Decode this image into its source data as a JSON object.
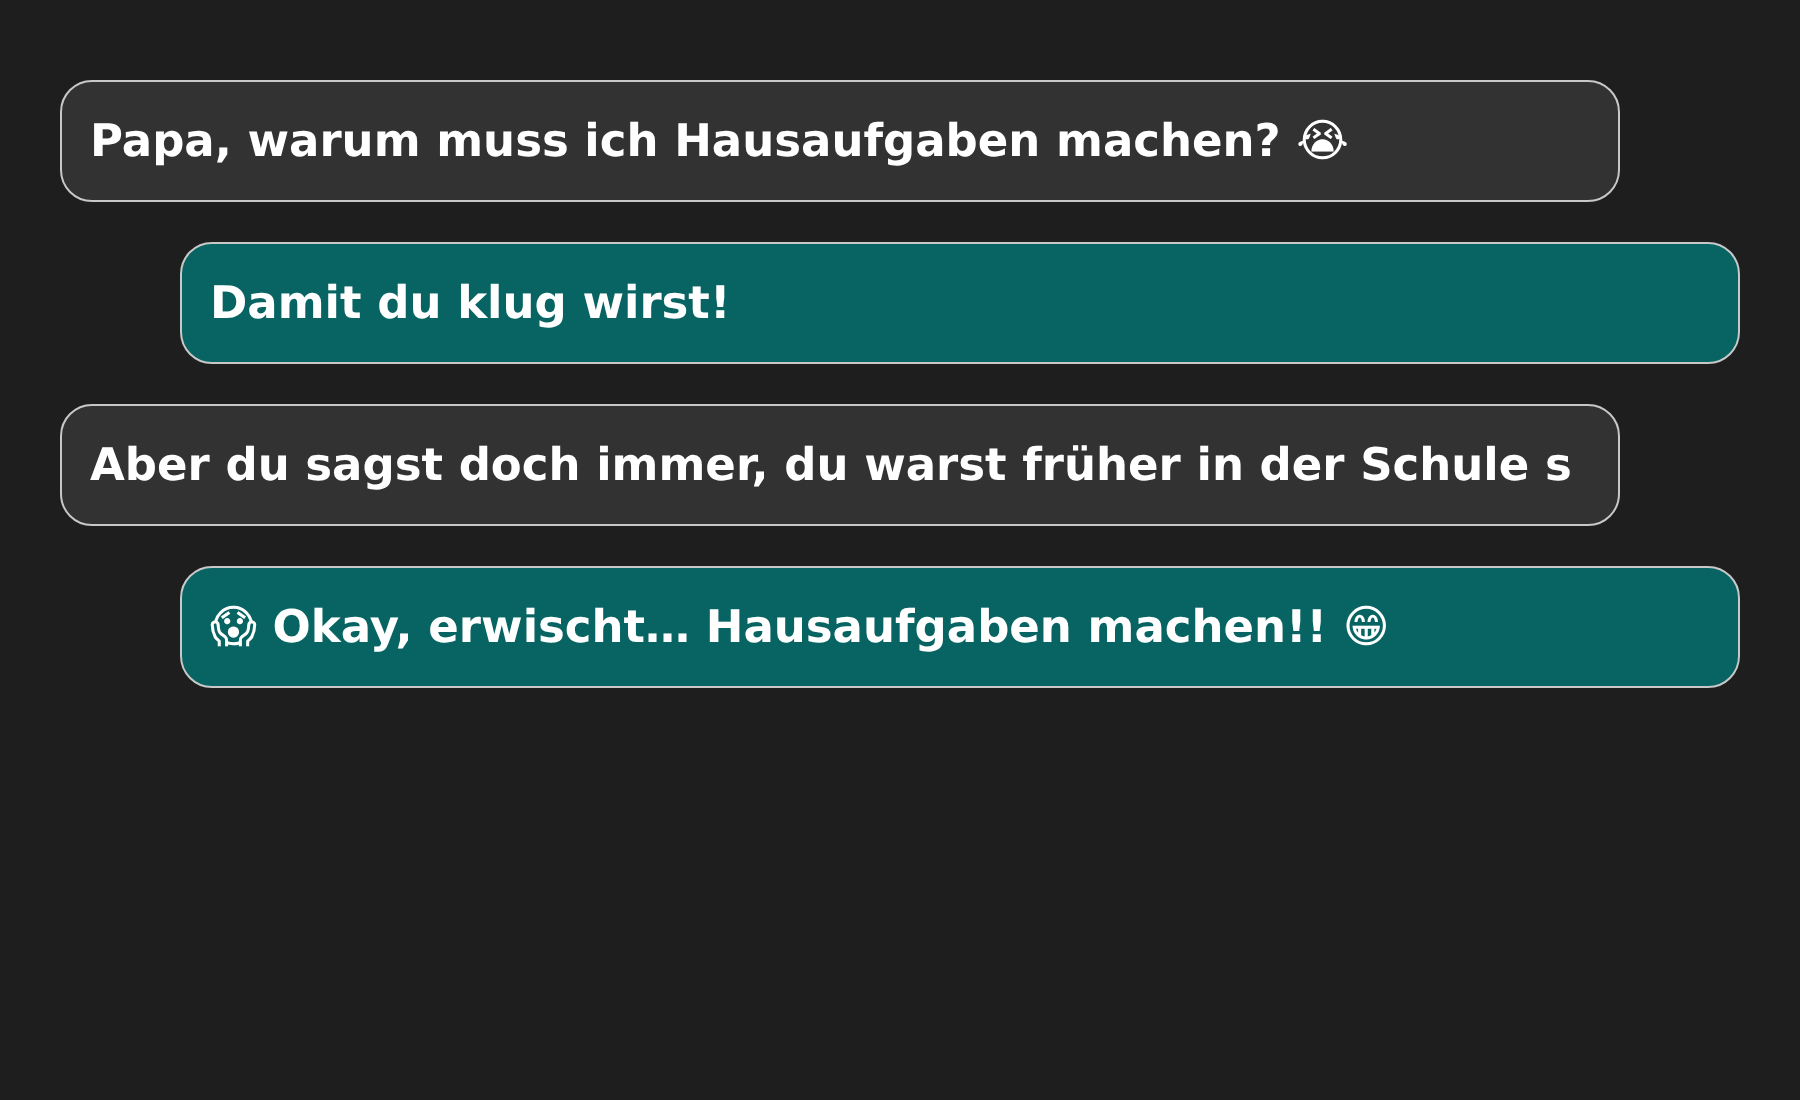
{
  "messages": [
    {
      "kind": "incoming",
      "text": "Papa, warum muss ich Hausaufgaben machen? 😭"
    },
    {
      "kind": "outgoing",
      "text": "Damit du klug wirst!"
    },
    {
      "kind": "incoming",
      "text": "Aber du sagst doch immer, du warst früher in der Schule s"
    },
    {
      "kind": "outgoing",
      "text": "😱 Okay, erwischt… Hausaufgaben machen!! 😁"
    }
  ]
}
